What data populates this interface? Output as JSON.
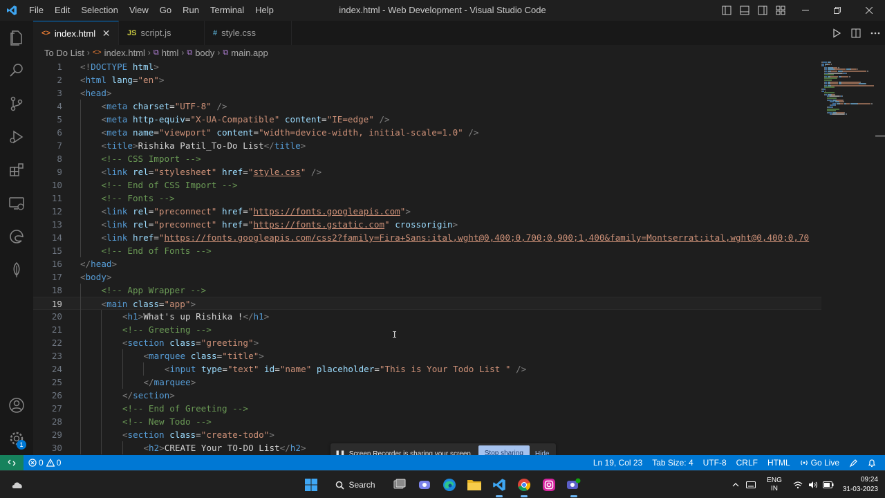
{
  "window": {
    "menu": [
      "File",
      "Edit",
      "Selection",
      "View",
      "Go",
      "Run",
      "Terminal",
      "Help"
    ],
    "title": "index.html - Web Development - Visual Studio Code"
  },
  "tabs": [
    {
      "icon": "<>",
      "label": "index.html",
      "active": true,
      "icon_color": "#e37933"
    },
    {
      "icon": "JS",
      "label": "script.js",
      "active": false,
      "icon_color": "#cbcb41"
    },
    {
      "icon": "#",
      "label": "style.css",
      "active": false,
      "icon_color": "#519aba"
    }
  ],
  "breadcrumb": [
    "To Do List",
    "index.html",
    "html",
    "body",
    "main.app"
  ],
  "editor": {
    "current_line": 19,
    "lines": [
      {
        "n": "1",
        "indent": 0,
        "t": [
          [
            "t",
            "<!"
          ],
          [
            "tn",
            "DOCTYPE"
          ],
          [
            "tx",
            " "
          ],
          [
            "an",
            "html"
          ],
          [
            "t",
            ">"
          ]
        ]
      },
      {
        "n": "2",
        "indent": 0,
        "t": [
          [
            "t",
            "<"
          ],
          [
            "tn",
            "html"
          ],
          [
            "tx",
            " "
          ],
          [
            "an",
            "lang"
          ],
          [
            "tx",
            "="
          ],
          [
            "av",
            "\"en\""
          ],
          [
            "t",
            ">"
          ]
        ]
      },
      {
        "n": "3",
        "indent": 0,
        "t": [
          [
            "t",
            "<"
          ],
          [
            "tn",
            "head"
          ],
          [
            "t",
            ">"
          ]
        ]
      },
      {
        "n": "4",
        "indent": 1,
        "t": [
          [
            "t",
            "<"
          ],
          [
            "tn",
            "meta"
          ],
          [
            "tx",
            " "
          ],
          [
            "an",
            "charset"
          ],
          [
            "tx",
            "="
          ],
          [
            "av",
            "\"UTF-8\""
          ],
          [
            "tx",
            " "
          ],
          [
            "t",
            "/>"
          ]
        ]
      },
      {
        "n": "5",
        "indent": 1,
        "t": [
          [
            "t",
            "<"
          ],
          [
            "tn",
            "meta"
          ],
          [
            "tx",
            " "
          ],
          [
            "an",
            "http-equiv"
          ],
          [
            "tx",
            "="
          ],
          [
            "av",
            "\"X-UA-Compatible\""
          ],
          [
            "tx",
            " "
          ],
          [
            "an",
            "content"
          ],
          [
            "tx",
            "="
          ],
          [
            "av",
            "\"IE=edge\""
          ],
          [
            "tx",
            " "
          ],
          [
            "t",
            "/>"
          ]
        ]
      },
      {
        "n": "6",
        "indent": 1,
        "t": [
          [
            "t",
            "<"
          ],
          [
            "tn",
            "meta"
          ],
          [
            "tx",
            " "
          ],
          [
            "an",
            "name"
          ],
          [
            "tx",
            "="
          ],
          [
            "av",
            "\"viewport\""
          ],
          [
            "tx",
            " "
          ],
          [
            "an",
            "content"
          ],
          [
            "tx",
            "="
          ],
          [
            "av",
            "\"width=device-width, initial-scale=1.0\""
          ],
          [
            "tx",
            " "
          ],
          [
            "t",
            "/>"
          ]
        ]
      },
      {
        "n": "7",
        "indent": 1,
        "t": [
          [
            "t",
            "<"
          ],
          [
            "tn",
            "title"
          ],
          [
            "t",
            ">"
          ],
          [
            "tx",
            "Rishika Patil_To-Do List"
          ],
          [
            "t",
            "</"
          ],
          [
            "tn",
            "title"
          ],
          [
            "t",
            ">"
          ]
        ]
      },
      {
        "n": "8",
        "indent": 1,
        "t": [
          [
            "cm",
            "<!-- CSS Import -->"
          ]
        ]
      },
      {
        "n": "9",
        "indent": 1,
        "t": [
          [
            "t",
            "<"
          ],
          [
            "tn",
            "link"
          ],
          [
            "tx",
            " "
          ],
          [
            "an",
            "rel"
          ],
          [
            "tx",
            "="
          ],
          [
            "av",
            "\"stylesheet\""
          ],
          [
            "tx",
            " "
          ],
          [
            "an",
            "href"
          ],
          [
            "tx",
            "="
          ],
          [
            "av",
            "\""
          ],
          [
            "avu",
            "style.css"
          ],
          [
            "av",
            "\""
          ],
          [
            "tx",
            " "
          ],
          [
            "t",
            "/>"
          ]
        ]
      },
      {
        "n": "10",
        "indent": 1,
        "t": [
          [
            "cm",
            "<!-- End of CSS Import -->"
          ]
        ]
      },
      {
        "n": "11",
        "indent": 1,
        "t": [
          [
            "cm",
            "<!-- Fonts -->"
          ]
        ]
      },
      {
        "n": "12",
        "indent": 1,
        "t": [
          [
            "t",
            "<"
          ],
          [
            "tn",
            "link"
          ],
          [
            "tx",
            " "
          ],
          [
            "an",
            "rel"
          ],
          [
            "tx",
            "="
          ],
          [
            "av",
            "\"preconnect\""
          ],
          [
            "tx",
            " "
          ],
          [
            "an",
            "href"
          ],
          [
            "tx",
            "="
          ],
          [
            "av",
            "\""
          ],
          [
            "avu",
            "https://fonts.googleapis.com"
          ],
          [
            "av",
            "\""
          ],
          [
            "t",
            ">"
          ]
        ]
      },
      {
        "n": "13",
        "indent": 1,
        "t": [
          [
            "t",
            "<"
          ],
          [
            "tn",
            "link"
          ],
          [
            "tx",
            " "
          ],
          [
            "an",
            "rel"
          ],
          [
            "tx",
            "="
          ],
          [
            "av",
            "\"preconnect\""
          ],
          [
            "tx",
            " "
          ],
          [
            "an",
            "href"
          ],
          [
            "tx",
            "="
          ],
          [
            "av",
            "\""
          ],
          [
            "avu",
            "https://fonts.gstatic.com"
          ],
          [
            "av",
            "\""
          ],
          [
            "tx",
            " "
          ],
          [
            "an",
            "crossorigin"
          ],
          [
            "t",
            ">"
          ]
        ]
      },
      {
        "n": "14",
        "indent": 1,
        "t": [
          [
            "t",
            "<"
          ],
          [
            "tn",
            "link"
          ],
          [
            "tx",
            " "
          ],
          [
            "an",
            "href"
          ],
          [
            "tx",
            "="
          ],
          [
            "av",
            "\""
          ],
          [
            "avu",
            "https://fonts.googleapis.com/css2?family=Fira+Sans:ital,wght@0,400;0,700;0,900;1,400&family=Montserrat:ital,wght@0,400;0,70"
          ]
        ]
      },
      {
        "n": "15",
        "indent": 1,
        "t": [
          [
            "cm",
            "<!-- End of Fonts -->"
          ]
        ]
      },
      {
        "n": "16",
        "indent": 0,
        "t": [
          [
            "t",
            "</"
          ],
          [
            "tn",
            "head"
          ],
          [
            "t",
            ">"
          ]
        ]
      },
      {
        "n": "17",
        "indent": 0,
        "t": [
          [
            "t",
            "<"
          ],
          [
            "tn",
            "body"
          ],
          [
            "t",
            ">"
          ]
        ]
      },
      {
        "n": "18",
        "indent": 1,
        "t": [
          [
            "cm",
            "<!-- App Wrapper -->"
          ]
        ]
      },
      {
        "n": "19",
        "indent": 1,
        "t": [
          [
            "t",
            "<"
          ],
          [
            "tn",
            "main"
          ],
          [
            "tx",
            " "
          ],
          [
            "an",
            "class"
          ],
          [
            "tx",
            "="
          ],
          [
            "av",
            "\"app\""
          ],
          [
            "t",
            ">"
          ]
        ]
      },
      {
        "n": "20",
        "indent": 2,
        "t": [
          [
            "t",
            "<"
          ],
          [
            "tn",
            "h1"
          ],
          [
            "t",
            ">"
          ],
          [
            "tx",
            "What's up Rishika !"
          ],
          [
            "t",
            "</"
          ],
          [
            "tn",
            "h1"
          ],
          [
            "t",
            ">"
          ]
        ]
      },
      {
        "n": "21",
        "indent": 2,
        "t": [
          [
            "cm",
            "<!-- Greeting -->"
          ]
        ]
      },
      {
        "n": "22",
        "indent": 2,
        "t": [
          [
            "t",
            "<"
          ],
          [
            "tn",
            "section"
          ],
          [
            "tx",
            " "
          ],
          [
            "an",
            "class"
          ],
          [
            "tx",
            "="
          ],
          [
            "av",
            "\"greeting\""
          ],
          [
            "t",
            ">"
          ]
        ]
      },
      {
        "n": "23",
        "indent": 3,
        "t": [
          [
            "t",
            "<"
          ],
          [
            "tn",
            "marquee"
          ],
          [
            "tx",
            " "
          ],
          [
            "an",
            "class"
          ],
          [
            "tx",
            "="
          ],
          [
            "av",
            "\"title\""
          ],
          [
            "t",
            ">"
          ]
        ]
      },
      {
        "n": "24",
        "indent": 4,
        "t": [
          [
            "t",
            "<"
          ],
          [
            "tn",
            "input"
          ],
          [
            "tx",
            " "
          ],
          [
            "an",
            "type"
          ],
          [
            "tx",
            "="
          ],
          [
            "av",
            "\"text\""
          ],
          [
            "tx",
            " "
          ],
          [
            "an",
            "id"
          ],
          [
            "tx",
            "="
          ],
          [
            "av",
            "\"name\""
          ],
          [
            "tx",
            " "
          ],
          [
            "an",
            "placeholder"
          ],
          [
            "tx",
            "="
          ],
          [
            "av",
            "\"This is Your Todo List \""
          ],
          [
            "tx",
            " "
          ],
          [
            "t",
            "/>"
          ]
        ]
      },
      {
        "n": "25",
        "indent": 3,
        "t": [
          [
            "t",
            "</"
          ],
          [
            "tn",
            "marquee"
          ],
          [
            "t",
            ">"
          ]
        ]
      },
      {
        "n": "26",
        "indent": 2,
        "t": [
          [
            "t",
            "</"
          ],
          [
            "tn",
            "section"
          ],
          [
            "t",
            ">"
          ]
        ]
      },
      {
        "n": "27",
        "indent": 2,
        "t": [
          [
            "cm",
            "<!-- End of Greeting -->"
          ]
        ]
      },
      {
        "n": "28",
        "indent": 2,
        "t": [
          [
            "cm",
            "<!-- New Todo -->"
          ]
        ]
      },
      {
        "n": "29",
        "indent": 2,
        "t": [
          [
            "t",
            "<"
          ],
          [
            "tn",
            "section"
          ],
          [
            "tx",
            " "
          ],
          [
            "an",
            "class"
          ],
          [
            "tx",
            "="
          ],
          [
            "av",
            "\"create-todo\""
          ],
          [
            "t",
            ">"
          ]
        ]
      },
      {
        "n": "30",
        "indent": 3,
        "t": [
          [
            "t",
            "<"
          ],
          [
            "tn",
            "h2"
          ],
          [
            "t",
            ">"
          ],
          [
            "tx",
            "CREATE Your TO-DO List"
          ],
          [
            "t",
            "</"
          ],
          [
            "tn",
            "h2"
          ],
          [
            "t",
            ">"
          ]
        ]
      }
    ]
  },
  "statusbar": {
    "errors": "0",
    "warnings": "0",
    "position": "Ln 19, Col 23",
    "tab_size": "Tab Size: 4",
    "encoding": "UTF-8",
    "eol": "CRLF",
    "language": "HTML",
    "live": "Go Live"
  },
  "share_notice": {
    "text": "Screen Recorder is sharing your screen.",
    "stop": "Stop sharing",
    "hide": "Hide"
  },
  "taskbar": {
    "search": "Search",
    "lang_top": "ENG",
    "lang_bottom": "IN",
    "time": "09:24",
    "date": "31-03-2023"
  },
  "activity_badge": "1"
}
